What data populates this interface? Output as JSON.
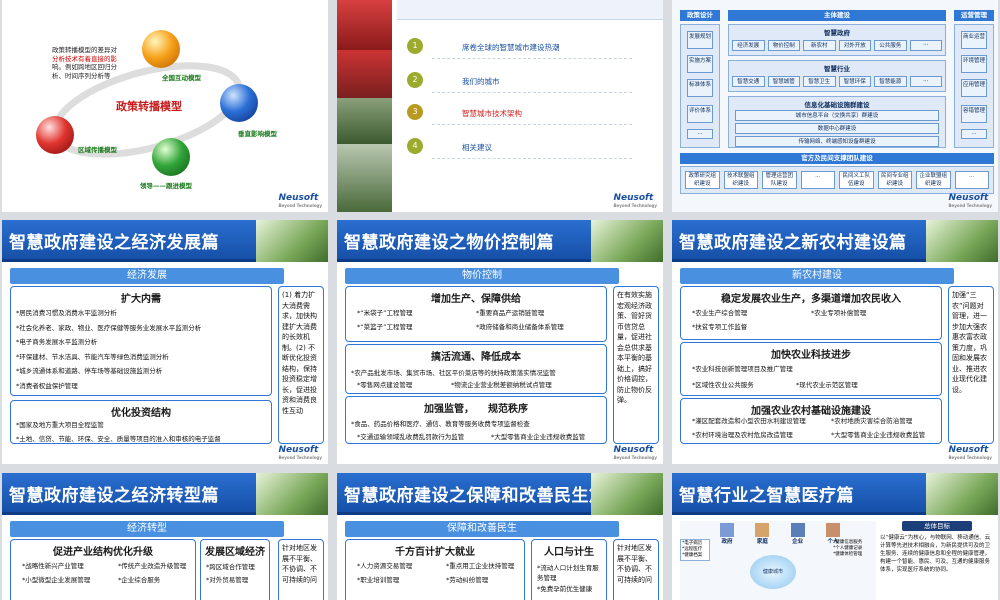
{
  "s1": {
    "desc": [
      "政策转播模型的差异对",
      "分析技术有着直接的影",
      "响。例如跨地区回归分",
      "析、时间序列分析等"
    ],
    "title": "政策转播模型",
    "labels": [
      "全国互动模型",
      "垂直影响模型",
      "领导——跟进模型",
      "区域传播模型"
    ],
    "logo": "Neusoft"
  },
  "s2": {
    "agenda": [
      "席卷全球的智慧城市建设热潮",
      "我们的城市",
      "智慧城市技术架构",
      "相关建议"
    ],
    "nums": [
      "1",
      "2",
      "3",
      "4"
    ],
    "logo": "Neusoft"
  },
  "s3": {
    "heads": [
      "政策设计",
      "主体建设",
      "运营管理"
    ],
    "left": [
      "发展规划",
      "实施方案",
      "标准体系",
      "评价体系",
      "..."
    ],
    "right": [
      "商业运营",
      "环境管理",
      "应用管理",
      "容错管理",
      "..."
    ],
    "gov": "智慧政府",
    "gov_items": [
      "经济发展",
      "物价控制",
      "新农村",
      "对外开放",
      "公共服务",
      "..."
    ],
    "ind": "智慧行业",
    "ind_items": [
      "智慧交通",
      "智慧城管",
      "智慧卫生",
      "智慧环保",
      "智慧能源",
      "..."
    ],
    "infra": "信息化基础设施群建设",
    "infra_rows": [
      "城市信息平台（交换共享）群建设",
      "数据中心群建设",
      "传输网络、终端感知设备群建设"
    ],
    "team": "官方及民间支撑团队建设",
    "team_items": [
      "政策研究组织建设",
      "技术联盟组织建设",
      "管理运营团队建设",
      "...",
      "民间义工队伍建设",
      "民间专业组织建设",
      "企业联盟组织建设",
      "..."
    ],
    "logo": "Neusoft"
  },
  "s4": {
    "title": "智慧政府建设之经济发展篇",
    "sub": "经济发展",
    "h1": "扩大内需",
    "items1": [
      "*居民消费习惯及消费水平监测分析",
      "*社会化养老、家政、物业、医疗保健等服务业发展水平监测分析",
      "*电子商务发展水平监测分析",
      "*环保建材、节水洁具、节能汽车等绿色消费监测分析",
      "*城乡流通体系和道路、停车场等基础设施监测分析",
      "*消费者权益保护管理"
    ],
    "h2": "优化投资结构",
    "items2": [
      "*国家及地方重大项目全程监管",
      "*土地、信贷、节能、环保、安全、质量等项目的准入和审核的电子监督"
    ],
    "side": "(1) 着力扩大消费需求，加快构建扩大消费的长效机制。(2) 不断优化投资结构，保持投资稳定增长，促进投资和消费良性互动",
    "logo": "Neusoft"
  },
  "s5": {
    "title": "智慧政府建设之物价控制篇",
    "sub": "物价控制",
    "h1": "增加生产、保障供给",
    "items1": [
      "*“米袋子”工程管理",
      "*“菜篮子”工程管理",
      "*重要商品产运销链管理",
      "*政府储备和商业储备体系管理"
    ],
    "h2": "搞活流通、降低成本",
    "items2": [
      "*农产品批发市场、集贸市场、社区平价菜店等的扶持政策落实情况监管",
      "*零售网点建设管理",
      "*物流企业营业税差额纳税试点管理"
    ],
    "h3a": "加强监管，",
    "h3b": "规范秩序",
    "items3": [
      "*食品、药品价格和医疗、通信、教育等服务收费专项监督检查",
      "*交通运输领域乱收费乱罚款行为监管",
      "*大型零售商业企业违规收费监管"
    ],
    "side": "在有效实施宏观经济政策、管好货币信贷总量，促进社会总供求基本平衡的基础上，搞好价格调控，防止物价反弹。",
    "logo": "Neusoft"
  },
  "s6": {
    "title": "智慧政府建设之新农村建设篇",
    "sub": "新农村建设",
    "h1": "稳定发展农业生产，多渠道增加农民收入",
    "items1": [
      "*农业生产综合管理",
      "*扶贫专项工作监督",
      "*农业专项补偿管理"
    ],
    "h2": "加快农业科技进步",
    "items2": [
      "*农业科技创新管理项目及推广管理",
      "*区域性农业公共服务",
      "*现代农业示范区管理"
    ],
    "h3": "加强农业农村基础设施建设",
    "items3": [
      "*灌区配套改造和小型农田水利建设管理",
      "*农村地质灾害综合防治管理",
      "*农村环境治理及农村危房改造管理",
      "*大型零售商业企业违规收费监管"
    ],
    "side": "加强“三农”问题对管理，进一步加大强农惠农富农政策力度，巩固和发展农业、推进农业现代化建设。",
    "logo": "Neusoft"
  },
  "s7": {
    "title": "智慧政府建设之经济转型篇",
    "sub": "经济转型",
    "h1": "促进产业结构优化升级",
    "items1": [
      "*战略性新兴产业管理",
      "*小型微型企业发展管理",
      "*传统产业改造升级管理",
      "*企业综合服务"
    ],
    "h2": "发展区域经济",
    "items2": [
      "*跨区域合作管理",
      "*对外贸易管理"
    ],
    "side": "针对地区发展不平衡、不协调、不可持续的问"
  },
  "s8": {
    "title": "智慧政府建设之保障和改善民生篇",
    "sub": "保障和改善民生",
    "h1": "千方百计扩大就业",
    "items1": [
      "*人力资源交易管理",
      "*职业培训管理",
      "*重点用工企业扶持管理",
      "*劳动纠纷管理"
    ],
    "h2": "人口与计生",
    "items2": [
      "*流动人口计划生育服务管理",
      "*免费孕前优生健康"
    ],
    "side": "针对地区发展不平衡、不协调、不可持续的问"
  },
  "s9": {
    "title": "智慧行业之智慧医疗篇",
    "goal": "总体目标",
    "goal_text": "以“健康云”为核心，与物联网、移动通信、云计算等先进技术相融合，为新民提供可及的卫生服务、连续的健康信息和全程的健康管理，构建一个智能、惠民、可及、互通的健康服务体系，实现医疗系统的协同。",
    "nodes": [
      "政府",
      "家庭",
      "企业",
      "个人"
    ],
    "center": "健康城市",
    "left_notes": [
      "*电子病历",
      "*远程医疗",
      "*健康档案"
    ],
    "right_notes": [
      "*健康信息服务",
      "*个人健康记录",
      "*健康体检管理"
    ]
  }
}
